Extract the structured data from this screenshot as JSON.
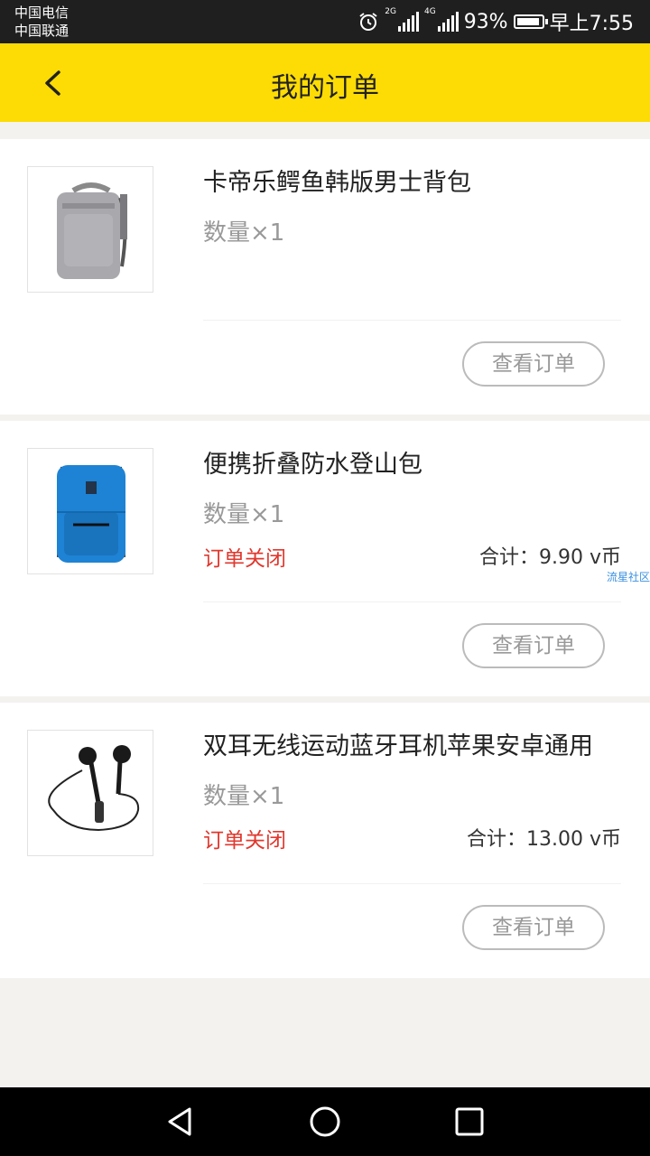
{
  "status_bar": {
    "carrier_1": "中国电信",
    "carrier_2": "中国联通",
    "network_1": "2G",
    "network_2": "4G",
    "battery": "93%",
    "battery_level": 0.93,
    "time": "早上7:55",
    "icons": [
      "alarm-icon",
      "signal-icon",
      "battery-icon"
    ]
  },
  "header": {
    "title": "我的订单",
    "back_icon": "chevron-left-icon"
  },
  "orders": [
    {
      "name": "卡帝乐鳄鱼韩版男士背包",
      "quantity": "数量×1",
      "status": "",
      "total": "",
      "action": "查看订单",
      "image": "gray-backpack"
    },
    {
      "name": "便携折叠防水登山包",
      "quantity": "数量×1",
      "status": "订单关闭",
      "total": "合计：9.90 v币",
      "action": "查看订单",
      "image": "blue-backpack",
      "watermark": "流星社区"
    },
    {
      "name": "双耳无线运动蓝牙耳机苹果安卓通用",
      "quantity": "数量×1",
      "status": "订单关闭",
      "total": "合计：13.00 v币",
      "action": "查看订单",
      "image": "black-earphones"
    }
  ],
  "nav_bar": {
    "icons": [
      "back-triangle-icon",
      "home-circle-icon",
      "recents-square-icon"
    ]
  },
  "colors": {
    "accent": "#fcdc04",
    "status_closed": "#e0382e",
    "background": "#f4f2ef"
  }
}
